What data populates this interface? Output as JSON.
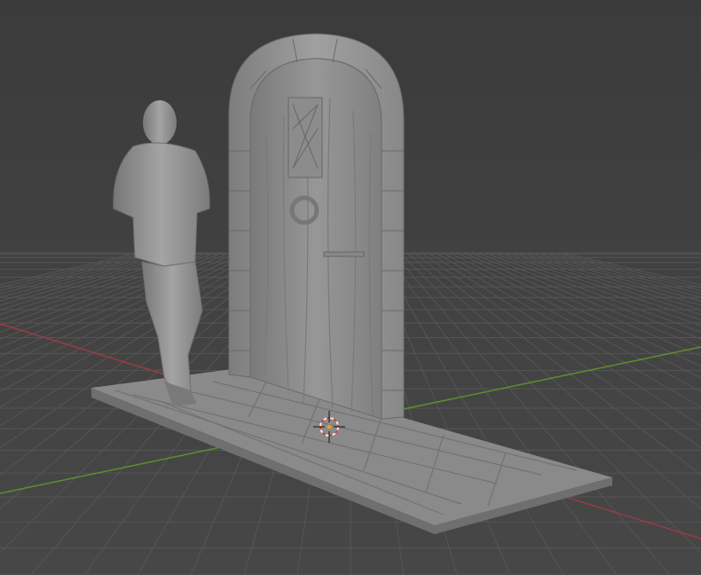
{
  "viewport": {
    "background": "#3d3d3d",
    "grid_color": "#555555",
    "x_axis_color": "#9b3b46",
    "y_axis_color": "#5f8f2c",
    "model_color": "#8e8e8e"
  },
  "objects": [
    {
      "name": "stone-base"
    },
    {
      "name": "arched-door"
    },
    {
      "name": "standing-figure"
    }
  ],
  "icons": {
    "cursor": "3d-cursor-icon"
  }
}
